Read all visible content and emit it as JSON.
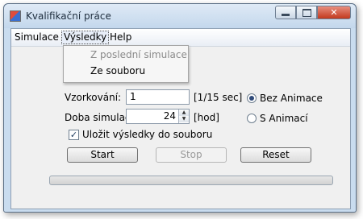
{
  "window": {
    "title": "Kvalifikační práce",
    "minimize_icon": "minimize-icon",
    "maximize_icon": "maximize-icon",
    "close_label": "✕"
  },
  "menubar": {
    "items": [
      {
        "label": "Simulace"
      },
      {
        "label": "Výsledky",
        "active": true
      },
      {
        "label": "Help"
      }
    ]
  },
  "dropdown": {
    "items": [
      {
        "label": "Z poslední simulace",
        "enabled": false
      },
      {
        "label": "Ze souboru",
        "enabled": true
      }
    ]
  },
  "form": {
    "sampling_label": "Vzorkování:",
    "sampling_value": "1",
    "sampling_unit": "[1/15 sec]",
    "duration_label": "Doba simulace:",
    "duration_value": "24",
    "duration_unit": "[hod]",
    "save_results_label": "Uložit výsledky do souboru",
    "save_results_checked": true,
    "radio_no_animation": "Bez Animace",
    "radio_with_animation": "S Animací",
    "animation_selected": "Bez Animace"
  },
  "buttons": {
    "start": "Start",
    "stop": "Stop",
    "reset": "Reset"
  },
  "progress": {
    "value_fraction": 0
  }
}
